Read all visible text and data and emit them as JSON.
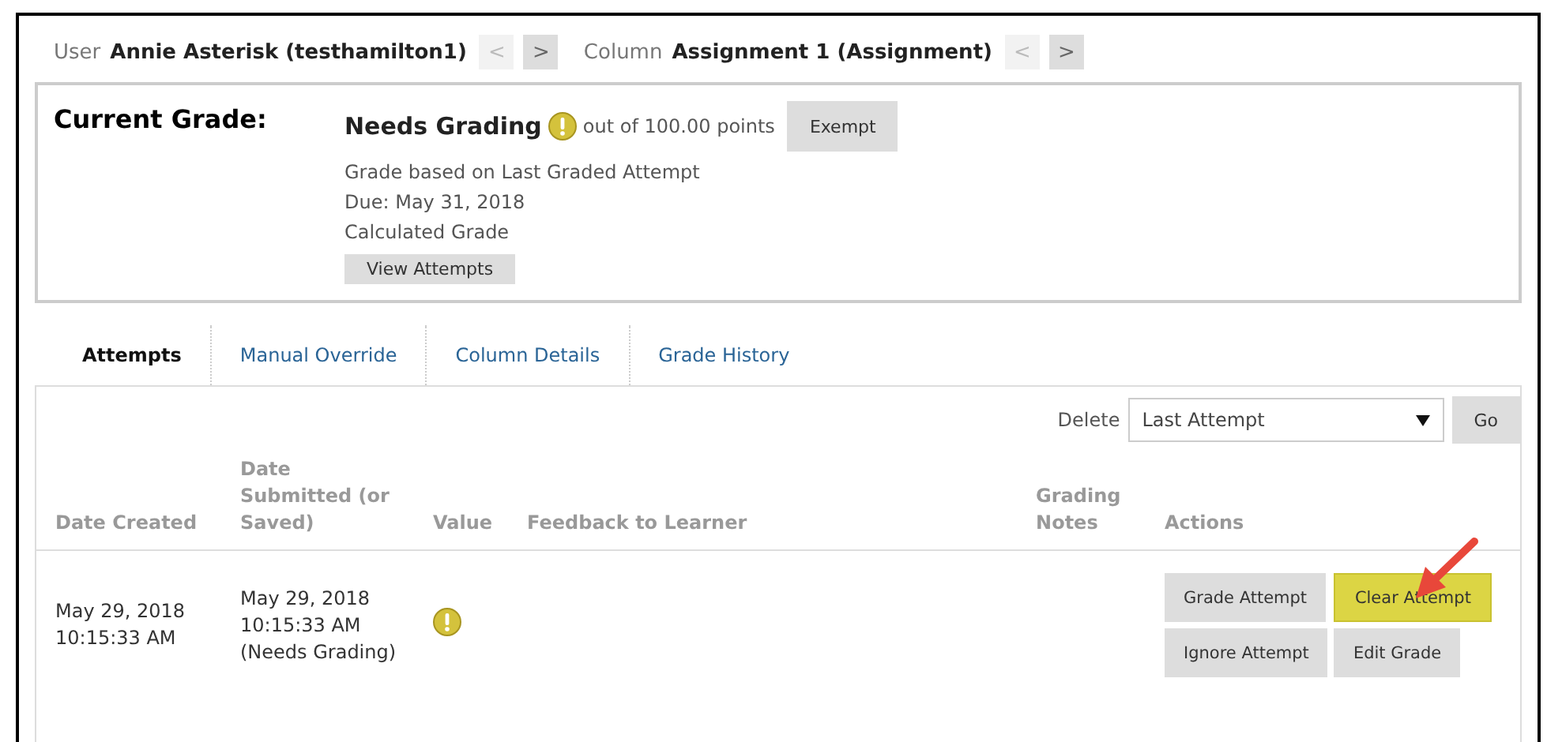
{
  "header": {
    "user_label": "User",
    "user_value": "Annie Asterisk (testhamilton1)",
    "user_nav": [
      {
        "symbol": "<",
        "disabled": true
      },
      {
        "symbol": ">",
        "disabled": false
      }
    ],
    "column_label": "Column",
    "column_value": "Assignment 1 (Assignment)",
    "column_nav": [
      {
        "symbol": "<",
        "disabled": true
      },
      {
        "symbol": ">",
        "disabled": false
      }
    ]
  },
  "current_grade": {
    "label": "Current Grade:",
    "status": "Needs Grading",
    "points": "out of 100.00 points",
    "exempt_button": "Exempt",
    "details": [
      "Grade based on Last Graded Attempt",
      "Due: May 31, 2018",
      "Calculated Grade"
    ],
    "view_button": "View Attempts"
  },
  "tabs": [
    {
      "label": "Attempts",
      "selected": true
    },
    {
      "label": "Manual Override",
      "selected": false
    },
    {
      "label": "Column Details",
      "selected": false
    },
    {
      "label": "Grade History",
      "selected": false
    }
  ],
  "delete": {
    "label": "Delete",
    "value": "Last Attempt",
    "go_button": "Go"
  },
  "table": {
    "columns": [
      "Date Created",
      "Date Submitted (or Saved)",
      "Value",
      "Feedback to Learner",
      "Grading Notes",
      "Actions"
    ],
    "rows": [
      {
        "created": "May 29, 2018 10:15:33 AM",
        "submitted": "May 29, 2018 10:15:33 AM (Needs Grading)",
        "actions": [
          {
            "label": "Grade Attempt",
            "highlighted": false
          },
          {
            "label": "Clear Attempt",
            "highlighted": true
          },
          {
            "label": "Ignore Attempt",
            "highlighted": false
          },
          {
            "label": "Edit Grade",
            "highlighted": false
          }
        ]
      }
    ]
  }
}
